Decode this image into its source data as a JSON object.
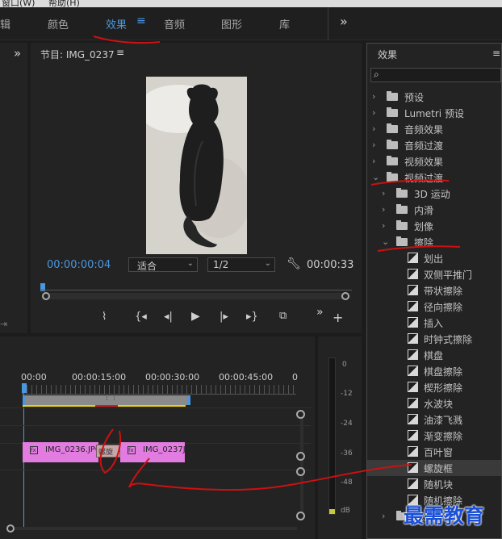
{
  "menu": {
    "item1": "窗口(W)",
    "item2": "帮助(H)"
  },
  "workspaces": {
    "tabs": [
      {
        "label": "辑"
      },
      {
        "label": "颜色"
      },
      {
        "label": "效果"
      },
      {
        "label": "音频"
      },
      {
        "label": "图形"
      },
      {
        "label": "库"
      }
    ],
    "active": "效果",
    "overflow": "»"
  },
  "program": {
    "title": "节目: IMG_0237",
    "menu_icon": "≡",
    "timecode_current": "00:00:00:04",
    "fit_value": "适合",
    "resolution_value": "1/2",
    "timecode_duration": "00:00:33"
  },
  "timeline": {
    "ruler": [
      "00:00",
      "00:00:15:00",
      "00:00:30:00",
      "00:00:45:00",
      "0"
    ],
    "clip1": "IMG_0236.JPG",
    "clip2": "IMG_0237J",
    "transition_label": "螺旋"
  },
  "meter": {
    "ticks": [
      "0",
      "-12",
      "-24",
      "-36",
      "-48",
      "dB"
    ]
  },
  "effects": {
    "title": "效果",
    "search_placeholder": "",
    "items": [
      {
        "label": "预设"
      },
      {
        "label": "Lumetri 预设"
      },
      {
        "label": "音频效果"
      },
      {
        "label": "音频过渡"
      },
      {
        "label": "视频效果"
      },
      {
        "label": "视频过渡"
      },
      {
        "label": "3D 运动"
      },
      {
        "label": "内滑"
      },
      {
        "label": "划像"
      },
      {
        "label": "擦除"
      },
      {
        "label": "划出"
      },
      {
        "label": "双侧平推门"
      },
      {
        "label": "带状擦除"
      },
      {
        "label": "径向擦除"
      },
      {
        "label": "插入"
      },
      {
        "label": "时钟式擦除"
      },
      {
        "label": "棋盘"
      },
      {
        "label": "棋盘擦除"
      },
      {
        "label": "楔形擦除"
      },
      {
        "label": "水波块"
      },
      {
        "label": "油漆飞溅"
      },
      {
        "label": "渐变擦除"
      },
      {
        "label": "百叶窗"
      },
      {
        "label": "螺旋框"
      },
      {
        "label": "随机块"
      },
      {
        "label": "随机擦除"
      },
      {
        "label": "沉浸式视频"
      }
    ]
  },
  "watermark": "最需教育",
  "colors": {
    "accent": "#4a97e0",
    "annotation": "#cc1111",
    "clip": "#e27ce0",
    "watermark": "#1a4fd6"
  }
}
